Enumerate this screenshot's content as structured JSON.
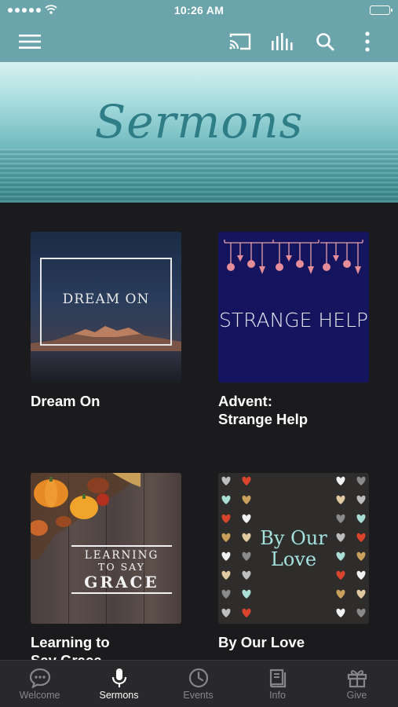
{
  "status_bar": {
    "time": "10:26 AM"
  },
  "toolbar": {
    "menu_icon": "hamburger-icon",
    "cast_icon": "cast-icon",
    "audio_icon": "equalizer-icon",
    "search_icon": "search-icon",
    "more_icon": "more-vertical-icon"
  },
  "banner": {
    "title": "Sermons"
  },
  "sermons": [
    {
      "title_lines": [
        "Dream On"
      ],
      "art_text": "DREAM ON"
    },
    {
      "title_lines": [
        "Advent:",
        "Strange Help"
      ],
      "art_text": "STRANGE HELP"
    },
    {
      "title_lines": [
        "Learning to",
        "Say Grace"
      ],
      "art_text_lines": [
        "LEARNING",
        "TO SAY",
        "GRACE"
      ]
    },
    {
      "title_lines": [
        "By Our Love"
      ],
      "art_text_lines": [
        "By Our",
        "Love"
      ]
    }
  ],
  "tabs": [
    {
      "label": "Welcome",
      "icon": "chat-bubble-icon",
      "active": false
    },
    {
      "label": "Sermons",
      "icon": "microphone-icon",
      "active": true
    },
    {
      "label": "Events",
      "icon": "clock-icon",
      "active": false
    },
    {
      "label": "Info",
      "icon": "book-icon",
      "active": false
    },
    {
      "label": "Give",
      "icon": "gift-icon",
      "active": false
    }
  ],
  "colors": {
    "header": "#6ba5ab",
    "background": "#1b1b1d",
    "tab_bar": "#29292c",
    "tab_inactive": "#86868a",
    "tab_active": "#ffffff"
  }
}
